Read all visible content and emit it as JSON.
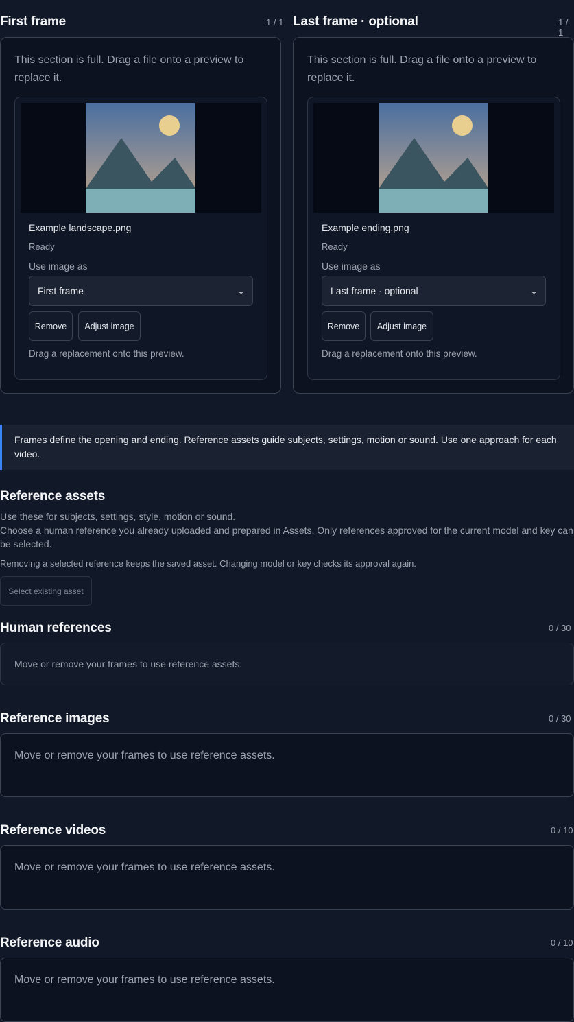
{
  "frames": [
    {
      "title": "First frame",
      "count": "1 / 1",
      "full_message": "This section is full. Drag a file onto a preview to replace it.",
      "file_name": "Example landscape.png",
      "status": "Ready",
      "use_as_label": "Use image as",
      "selected_option": "First frame",
      "remove_label": "Remove",
      "adjust_label": "Adjust image",
      "drag_hint": "Drag a replacement onto this preview."
    },
    {
      "title": "Last frame · optional",
      "count": "1 / 1",
      "full_message": "This section is full. Drag a file onto a preview to replace it.",
      "file_name": "Example ending.png",
      "status": "Ready",
      "use_as_label": "Use image as",
      "selected_option": "Last frame · optional",
      "remove_label": "Remove",
      "adjust_label": "Adjust image",
      "drag_hint": "Drag a replacement onto this preview."
    }
  ],
  "info_banner": "Frames define the opening and ending. Reference assets guide subjects, settings, motion or sound. Use one approach for each video.",
  "reference_assets": {
    "title": "Reference assets",
    "line1": "Use these for subjects, settings, style, motion or sound.",
    "line2": "Choose a human reference you already uploaded and prepared in Assets. Only references approved for the current model and key can be selected.",
    "line3": "Removing a selected reference keeps the saved asset. Changing model or key checks its approval again.",
    "select_button": "Select existing asset"
  },
  "sections": [
    {
      "title": "Human references",
      "count": "0 / 30",
      "message": "Move or remove your frames to use reference assets."
    },
    {
      "title": "Reference images",
      "count": "0 / 30",
      "message": "Move or remove your frames to use reference assets."
    },
    {
      "title": "Reference videos",
      "count": "0 / 10",
      "message": "Move or remove your frames to use reference assets."
    },
    {
      "title": "Reference audio",
      "count": "0 / 10",
      "message": "Move or remove your frames to use reference assets."
    }
  ],
  "colors": {
    "accent": "#3b82f6",
    "background": "#111827",
    "sky_top": "#4a6fa0",
    "sky_bottom": "#c6a98c",
    "sun": "#e8cf90",
    "mountain": "#3a5560",
    "water": "#7eaeb6"
  }
}
